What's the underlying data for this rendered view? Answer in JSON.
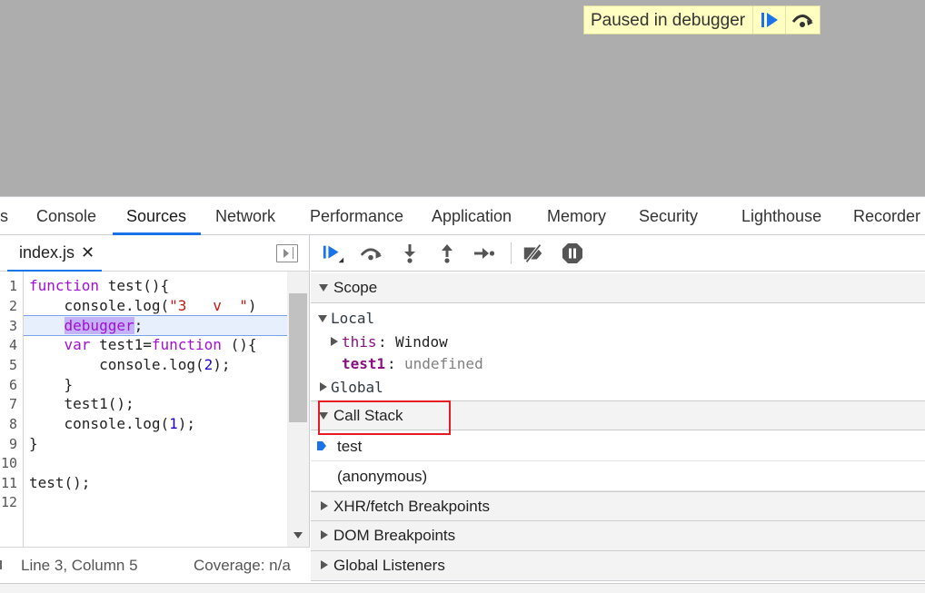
{
  "overlay": {
    "paused_text": "Paused in debugger",
    "resume_icon": "resume-icon",
    "step_over_icon": "step-over-icon"
  },
  "tabs": [
    {
      "label": "s"
    },
    {
      "label": "Console"
    },
    {
      "label": "Sources"
    },
    {
      "label": "Network"
    },
    {
      "label": "Performance"
    },
    {
      "label": "Application"
    },
    {
      "label": "Memory"
    },
    {
      "label": "Security"
    },
    {
      "label": "Lighthouse"
    },
    {
      "label": "Recorder"
    }
  ],
  "active_tab": "Sources",
  "editor": {
    "file_name": "index.js",
    "close_glyph": "✕",
    "line_numbers": [
      "1",
      "2",
      "3",
      "4",
      "5",
      "6",
      "7",
      "8",
      "9",
      "10",
      "11",
      "12"
    ],
    "current_line": 3,
    "status_position": "Line 3, Column 5",
    "status_coverage": "Coverage: n/a"
  },
  "debugger": {
    "toolbar_icons": [
      "resume-icon",
      "step-over-icon",
      "step-into-icon",
      "step-out-icon",
      "step-icon",
      "deactivate-breakpoints-icon",
      "pause-on-exceptions-icon"
    ],
    "scope": {
      "title": "Scope",
      "local_label": "Local",
      "this_key": "this",
      "this_value": "Window",
      "test1_key": "test1",
      "test1_value": "undefined",
      "global_label": "Global"
    },
    "call_stack": {
      "title": "Call Stack",
      "frames": [
        "test",
        "(anonymous)"
      ]
    },
    "sections": [
      "XHR/fetch Breakpoints",
      "DOM Breakpoints",
      "Global Listeners"
    ]
  },
  "colors": {
    "accent": "#1a73e8",
    "highlight_box": "#e51c23",
    "keyword": "#a20fd5",
    "string": "#c41a16",
    "number": "#1c00cf"
  }
}
